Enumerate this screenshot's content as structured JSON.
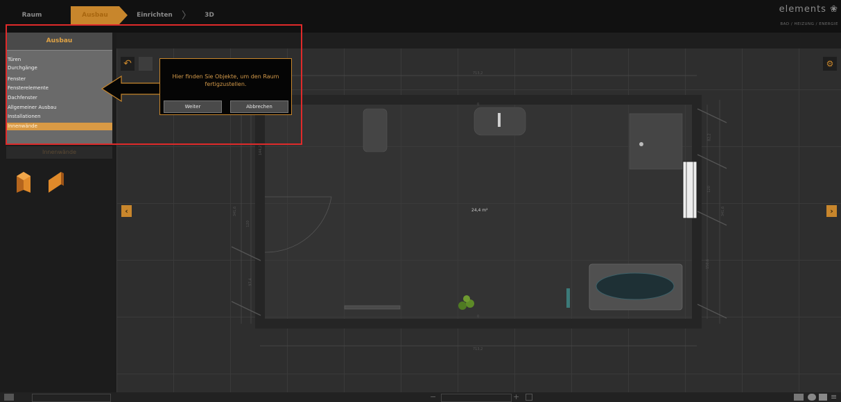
{
  "steps": [
    {
      "label": "Raum"
    },
    {
      "label": "Ausbau"
    },
    {
      "label": "Einrichten"
    },
    {
      "label": "3D"
    }
  ],
  "brand": {
    "name": "elements",
    "tagline": "BAD / HEIZUNG / ENERGIE"
  },
  "sidebar": {
    "header": "Ausbau",
    "items": [
      {
        "label": "Türen"
      },
      {
        "label": "Durchgänge"
      },
      {
        "label": "Fenster"
      },
      {
        "label": "Fensterelemente"
      },
      {
        "label": "Dachfenster"
      },
      {
        "label": "Allgemeiner Ausbau"
      },
      {
        "label": "Installationen"
      },
      {
        "label": "Innenwände"
      }
    ],
    "selected_index": 7,
    "section_label": "Innenwände"
  },
  "tooltip": {
    "text_line1": "Hier finden Sie Objekte, um den Raum",
    "text_line2": "fertigzustellen.",
    "next_label": "Weiter",
    "cancel_label": "Abbrechen"
  },
  "plan": {
    "area": "24,4 m²",
    "dim_top": "713,2",
    "dim_bottom": "713,2",
    "wall_top": "0",
    "wall_bottom": "0",
    "dims_left": [
      "144,2",
      "341,6",
      "120",
      "97,4"
    ],
    "dims_right": [
      "82,2",
      "120",
      "341,6",
      "150,6"
    ]
  },
  "colors": {
    "accent": "#c8862c",
    "highlight": "#e02a2a",
    "wall": "#2b2b2b",
    "floor": "#3a3a3a"
  },
  "icons": [
    "undo-icon",
    "settings-icon",
    "chevron-left-icon",
    "chevron-right-icon",
    "camera-icon",
    "upload-icon",
    "print-icon",
    "menu-icon"
  ]
}
